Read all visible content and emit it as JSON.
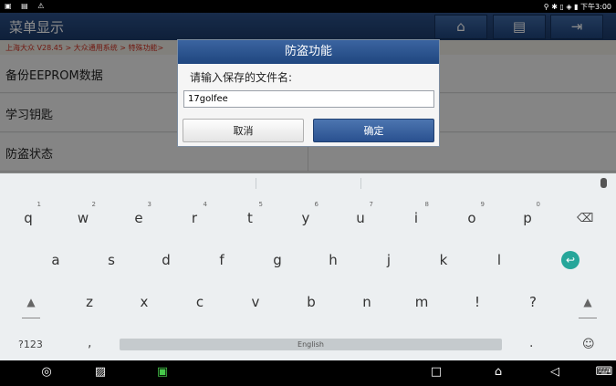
{
  "status_bar": {
    "time": "下午3:00"
  },
  "app": {
    "title": "菜单显示",
    "toolbar": {
      "home_icon": "home-icon",
      "print_icon": "printer-icon",
      "exit_icon": "exit-icon"
    }
  },
  "breadcrumb": "上海大众 V28.45 > 大众通用系统 > 特殊功能>",
  "menu": {
    "items": [
      "备份EEPROM数据",
      "学习钥匙",
      "防盗状态"
    ]
  },
  "dialog": {
    "title": "防盗功能",
    "prompt": "请输入保存的文件名:",
    "input_value": "17golfee",
    "cancel_label": "取消",
    "ok_label": "确定"
  },
  "keyboard": {
    "row1": [
      "q",
      "w",
      "e",
      "r",
      "t",
      "y",
      "u",
      "i",
      "o",
      "p"
    ],
    "row1_hints": [
      "1",
      "2",
      "3",
      "4",
      "5",
      "6",
      "7",
      "8",
      "9",
      "0"
    ],
    "row2": [
      "a",
      "s",
      "d",
      "f",
      "g",
      "h",
      "j",
      "k",
      "l"
    ],
    "row3": [
      "z",
      "x",
      "c",
      "v",
      "b",
      "n",
      "m",
      "!",
      "?"
    ],
    "symbols_label": "?123",
    "comma": ",",
    "space_label": "English",
    "period": ".",
    "emoji": "☺"
  },
  "colors": {
    "accent": "#1f467f",
    "breadcrumb": "#cc2d1f",
    "enter": "#26a69a"
  }
}
